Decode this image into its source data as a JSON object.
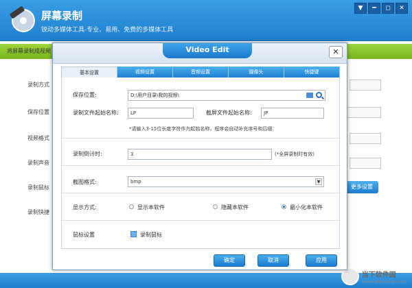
{
  "app": {
    "title": "屏幕录制",
    "subtitle": "锐动多媒体工具-专业、易用、免费的多媒体工具",
    "window_controls": [
      "▼",
      "━",
      "◻",
      "✕"
    ]
  },
  "background": {
    "green_bar_text": "将屏幕录制成视频",
    "labels": [
      "录制方式",
      "保存位置",
      "视频格式",
      "录制声音",
      "录制鼠标",
      "录制快捷"
    ],
    "more_settings_label": "更多设置",
    "watermark_text": "当下软件园",
    "watermark_url": "www.downxia.com"
  },
  "dialog": {
    "title": "Video Edit",
    "close_label": "✕",
    "tabs": [
      {
        "label": "基本设置",
        "active": true
      },
      {
        "label": "视频设置",
        "active": false
      },
      {
        "label": "音频设置",
        "active": false
      },
      {
        "label": "摄像头",
        "active": false
      },
      {
        "label": "快捷键",
        "active": false
      }
    ],
    "save_location": {
      "label": "保存位置:",
      "value": "D:\\用户目录\\我的视频\\"
    },
    "record_prefix": {
      "label": "录制文件起始名称:",
      "value": "LP"
    },
    "screenshot_prefix": {
      "label": "截屏文件起始名称:",
      "value": "JP"
    },
    "prefix_hint": "*请输入3-15位长度字符作为起始名称，程序会自动补充序号和后缀.",
    "countdown": {
      "label": "录制倒计时:",
      "value": "3",
      "hint": "(*全屏录制时有效)"
    },
    "screenshot_format": {
      "label": "截图格式:",
      "value": "bmp"
    },
    "display_mode": {
      "label": "显示方式:",
      "options": [
        {
          "label": "显示本软件",
          "checked": false
        },
        {
          "label": "隐藏本软件",
          "checked": false
        },
        {
          "label": "最小化本软件",
          "checked": true
        }
      ]
    },
    "mouse": {
      "section_label": "鼠标设置",
      "checkbox_label": "录制鼠标",
      "checked": true
    },
    "buttons": {
      "ok": "确定",
      "cancel": "取消",
      "apply": "应用"
    }
  }
}
